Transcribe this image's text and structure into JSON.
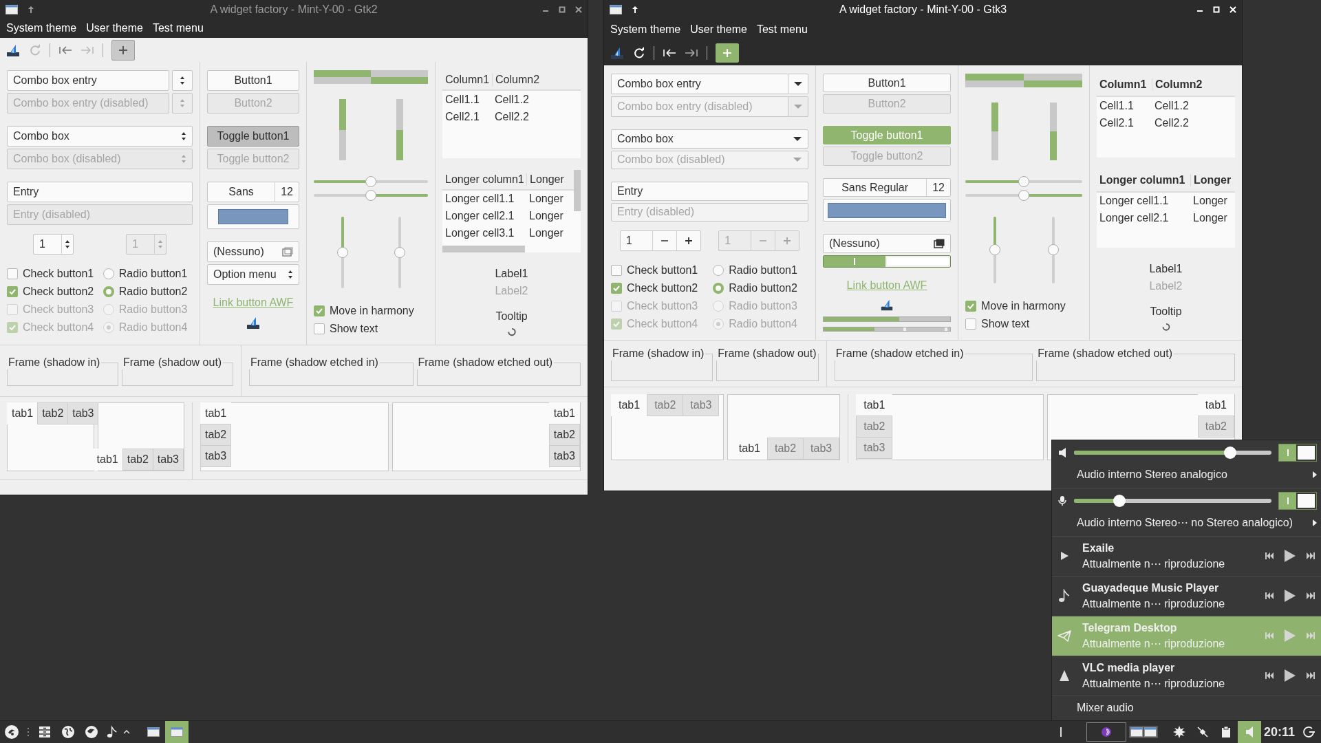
{
  "windows": [
    {
      "kind": "gtk2",
      "title": "A widget factory - Mint-Y-00 - Gtk2",
      "active": false,
      "menu": [
        "System theme",
        "User theme",
        "Test menu"
      ],
      "combos": [
        {
          "kind": "entry",
          "value": "Combo box entry",
          "disabled": false
        },
        {
          "kind": "entry",
          "value": "Combo box entry (disabled)",
          "disabled": true
        },
        {
          "kind": "combo",
          "value": "Combo box",
          "disabled": false
        },
        {
          "kind": "combo",
          "value": "Combo box (disabled)",
          "disabled": true
        }
      ],
      "entries": [
        {
          "value": "Entry",
          "disabled": false
        },
        {
          "value": "Entry (disabled)",
          "disabled": true
        }
      ],
      "spins": [
        {
          "value": "1",
          "disabled": false
        },
        {
          "value": "1",
          "disabled": true
        }
      ],
      "checks": [
        {
          "label": "Check button1",
          "checked": false,
          "disabled": false
        },
        {
          "label": "Check button2",
          "checked": true,
          "disabled": false
        },
        {
          "label": "Check button3",
          "checked": false,
          "disabled": true
        },
        {
          "label": "Check button4",
          "checked": true,
          "disabled": true
        }
      ],
      "radios": [
        {
          "label": "Radio button1",
          "selected": false,
          "inconsistent": false,
          "disabled": false
        },
        {
          "label": "Radio button2",
          "selected": true,
          "inconsistent": false,
          "disabled": false
        },
        {
          "label": "Radio button3",
          "selected": false,
          "inconsistent": false,
          "disabled": true
        },
        {
          "label": "Radio button4",
          "selected": false,
          "inconsistent": true,
          "disabled": true
        }
      ],
      "buttons": [
        {
          "label": "Button1",
          "disabled": false
        },
        {
          "label": "Button2",
          "disabled": true
        }
      ],
      "toggles": [
        {
          "label": "Toggle button1",
          "on": true,
          "disabled": false
        },
        {
          "label": "Toggle button2",
          "on": false,
          "disabled": true
        }
      ],
      "font": {
        "family": "Sans",
        "size": "12"
      },
      "file_chooser": "(Nessuno)",
      "option_menu": "Option menu",
      "link": "Link button AWF",
      "hprogress": [
        {
          "level": 0.5,
          "inverted": false
        },
        {
          "level": 0.5,
          "inverted": true
        }
      ],
      "vprogress": [
        {
          "level": 0.5,
          "inverted": false
        },
        {
          "level": 0.5,
          "inverted": true
        }
      ],
      "hscales": [
        {
          "level": 0.5,
          "inverted": false
        },
        {
          "level": 0.5,
          "inverted": true
        }
      ],
      "vscales": [
        {
          "level": 0.5,
          "inverted": false
        },
        {
          "level": 0.5,
          "inverted": true
        }
      ],
      "harmony": [
        {
          "label": "Move in harmony",
          "checked": true
        },
        {
          "label": "Show text",
          "checked": false
        }
      ],
      "tree1": {
        "columns": [
          "Column1",
          "Column2"
        ],
        "rows": [
          [
            "Cell1.1",
            "Cell1.2"
          ],
          [
            "Cell2.1",
            "Cell2.2"
          ]
        ]
      },
      "tree2": {
        "columns": [
          "Longer column1",
          "Longer"
        ],
        "rows": [
          [
            "Longer cell1.1",
            "Longer"
          ],
          [
            "Longer cell2.1",
            "Longer"
          ],
          [
            "Longer cell3.1",
            "Longer"
          ]
        ]
      },
      "labels": [
        {
          "text": "Label1",
          "disabled": false
        },
        {
          "text": "Label2",
          "disabled": true
        }
      ],
      "tooltip": "Tooltip",
      "frames": [
        "Frame (shadow in)",
        "Frame (shadow out)",
        "Frame (shadow etched in)",
        "Frame (shadow etched out)"
      ],
      "notebooks": [
        {
          "kind": "top",
          "tabs": [
            {
              "label": "tab1",
              "selected": true
            },
            {
              "label": "tab2",
              "selected": false
            },
            {
              "label": "tab3",
              "selected": false
            }
          ]
        },
        {
          "kind": "bottom",
          "tabs": [
            {
              "label": "tab1",
              "selected": true
            },
            {
              "label": "tab2",
              "selected": false
            },
            {
              "label": "tab3",
              "selected": false
            }
          ]
        },
        {
          "kind": "left",
          "tabs": [
            {
              "label": "tab1",
              "selected": true
            },
            {
              "label": "tab2",
              "selected": false
            },
            {
              "label": "tab3",
              "selected": false
            }
          ]
        },
        {
          "kind": "right",
          "tabs": [
            {
              "label": "tab1",
              "selected": true
            },
            {
              "label": "tab2",
              "selected": false
            },
            {
              "label": "tab3",
              "selected": false
            }
          ]
        }
      ]
    },
    {
      "kind": "gtk3",
      "title": "A widget factory - Mint-Y-00 - Gtk3",
      "active": true,
      "menu": [
        "System theme",
        "User theme",
        "Test menu"
      ],
      "combos": [
        {
          "kind": "entry",
          "value": "Combo box entry",
          "disabled": false
        },
        {
          "kind": "entry",
          "value": "Combo box entry (disabled)",
          "disabled": true
        },
        {
          "kind": "combo",
          "value": "Combo box",
          "disabled": false
        },
        {
          "kind": "combo",
          "value": "Combo box (disabled)",
          "disabled": true
        }
      ],
      "entries": [
        {
          "value": "Entry",
          "disabled": false
        },
        {
          "value": "Entry (disabled)",
          "disabled": true
        }
      ],
      "spins": [
        {
          "value": "1",
          "disabled": false
        },
        {
          "value": "1",
          "disabled": true
        }
      ],
      "checks": [
        {
          "label": "Check button1",
          "checked": false,
          "disabled": false
        },
        {
          "label": "Check button2",
          "checked": true,
          "disabled": false
        },
        {
          "label": "Check button3",
          "checked": false,
          "disabled": true
        },
        {
          "label": "Check button4",
          "checked": true,
          "disabled": true
        }
      ],
      "radios": [
        {
          "label": "Radio button1",
          "selected": false,
          "inconsistent": false,
          "disabled": false
        },
        {
          "label": "Radio button2",
          "selected": true,
          "inconsistent": false,
          "disabled": false
        },
        {
          "label": "Radio button3",
          "selected": false,
          "inconsistent": false,
          "disabled": true
        },
        {
          "label": "Radio button4",
          "selected": false,
          "inconsistent": true,
          "disabled": true
        }
      ],
      "buttons": [
        {
          "label": "Button1",
          "disabled": false
        },
        {
          "label": "Button2",
          "disabled": true
        }
      ],
      "toggles": [
        {
          "label": "Toggle button1",
          "on": true,
          "disabled": false
        },
        {
          "label": "Toggle button2",
          "on": false,
          "disabled": true
        }
      ],
      "font": {
        "family": "Sans Regular",
        "size": "12"
      },
      "file_chooser": "(Nessuno)",
      "switch": {
        "on": true
      },
      "link": "Link button AWF",
      "level_bars": [
        {
          "kind": "continuous",
          "level": 0.6
        },
        {
          "kind": "discrete",
          "level": 0.4
        }
      ],
      "hprogress": [
        {
          "level": 0.5,
          "inverted": false
        },
        {
          "level": 0.5,
          "inverted": true
        }
      ],
      "vprogress": [
        {
          "level": 0.5,
          "inverted": false
        },
        {
          "level": 0.5,
          "inverted": true
        }
      ],
      "hscales": [
        {
          "level": 0.5,
          "inverted": false
        },
        {
          "level": 0.5,
          "inverted": true
        }
      ],
      "vscales": [
        {
          "level": 0.5,
          "inverted": false
        },
        {
          "level": 0.5,
          "inverted": true
        }
      ],
      "harmony": [
        {
          "label": "Move in harmony",
          "checked": true
        },
        {
          "label": "Show text",
          "checked": false
        }
      ],
      "tree1": {
        "columns": [
          "Column1",
          "Column2"
        ],
        "rows": [
          [
            "Cell1.1",
            "Cell1.2"
          ],
          [
            "Cell2.1",
            "Cell2.2"
          ]
        ]
      },
      "tree2": {
        "columns": [
          "Longer column1",
          "Longer"
        ],
        "rows": [
          [
            "Longer cell1.1",
            "Longer"
          ],
          [
            "Longer cell2.1",
            "Longer"
          ]
        ]
      },
      "labels": [
        {
          "text": "Label1",
          "disabled": false
        },
        {
          "text": "Label2",
          "disabled": true
        }
      ],
      "tooltip": "Tooltip",
      "frames": [
        "Frame (shadow in)",
        "Frame (shadow out)",
        "Frame (shadow etched in)",
        "Frame (shadow etched out)"
      ],
      "notebooks": [
        {
          "kind": "top",
          "tabs": [
            {
              "label": "tab1",
              "selected": true
            },
            {
              "label": "tab2",
              "selected": false
            },
            {
              "label": "tab3",
              "selected": false
            }
          ]
        },
        {
          "kind": "bottom",
          "tabs": [
            {
              "label": "tab1",
              "selected": true
            },
            {
              "label": "tab2",
              "selected": false
            },
            {
              "label": "tab3",
              "selected": false
            }
          ]
        },
        {
          "kind": "left",
          "tabs": [
            {
              "label": "tab1",
              "selected": true
            },
            {
              "label": "tab2",
              "selected": false
            },
            {
              "label": "tab3",
              "selected": false
            }
          ]
        },
        {
          "kind": "right",
          "tabs": [
            {
              "label": "tab1",
              "selected": true
            },
            {
              "label": "tab2",
              "selected": false
            }
          ]
        }
      ]
    }
  ],
  "sound_menu": {
    "outputs": [
      {
        "kind": "speaker",
        "level": 0.79,
        "on": true,
        "device": "Audio interno Stereo analogico"
      },
      {
        "kind": "microphone",
        "level": 0.23,
        "on": true,
        "device": "Audio interno Stereo⋯ no Stereo analogico)"
      }
    ],
    "players": [
      {
        "kind": "play",
        "name": "Exaile",
        "status": "Attualmente n⋯ riproduzione",
        "selected": false
      },
      {
        "kind": "note",
        "name": "Guayadeque Music Player",
        "status": "Attualmente n⋯ riproduzione",
        "selected": false
      },
      {
        "kind": "plane",
        "name": "Telegram Desktop",
        "status": "Attualmente n⋯ riproduzione",
        "selected": true
      },
      {
        "kind": "cone",
        "name": "VLC media player",
        "status": "Attualmente n⋯ riproduzione",
        "selected": false
      }
    ],
    "mixer": "Mixer audio"
  },
  "taskbar": {
    "windows": [
      {
        "selected": false
      },
      {
        "selected": true
      }
    ],
    "clock": "20:11"
  }
}
